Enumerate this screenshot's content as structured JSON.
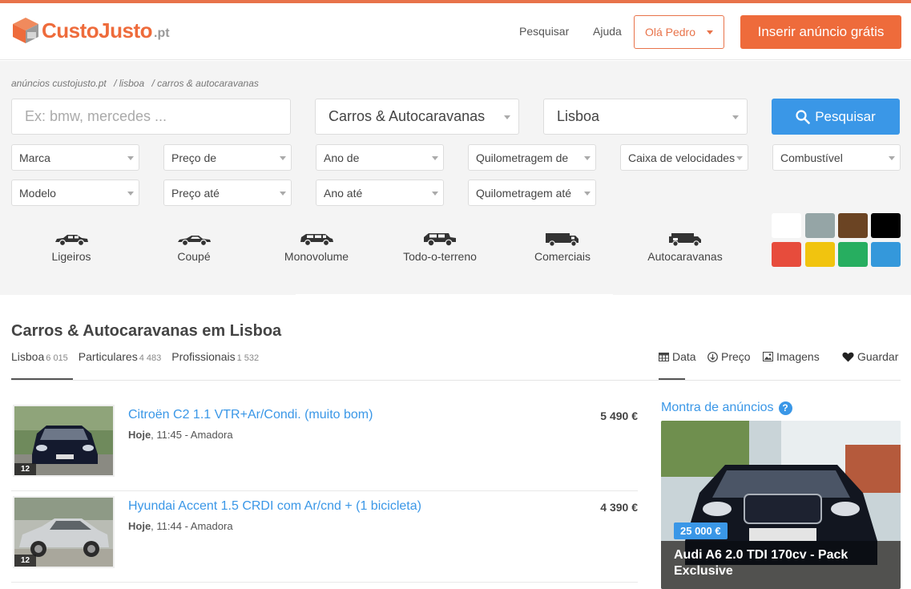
{
  "brand": {
    "name": "CustoJusto",
    "tld": ".pt",
    "accent": "#ee6b3b",
    "link_color": "#3a97e7"
  },
  "nav": {
    "search": "Pesquisar",
    "help": "Ajuda",
    "user": "Olá Pedro",
    "cta": "Inserir anúncio grátis"
  },
  "breadcrumb": [
    "anúncios custojusto.pt",
    "/ lisboa",
    "/ carros & autocaravanas"
  ],
  "search": {
    "query_placeholder": "Ex: bmw, mercedes ...",
    "category": "Carros & Autocaravanas",
    "region": "Lisboa",
    "button": "Pesquisar"
  },
  "filters": {
    "brand": "Marca",
    "price_from": "Preço de",
    "year_from": "Ano de",
    "km_from": "Quilometragem de",
    "gearbox": "Caixa de velocidades",
    "fuel": "Combustível",
    "model": "Modelo",
    "price_to": "Preço até",
    "year_to": "Ano até",
    "km_to": "Quilometragem até"
  },
  "body_types": [
    {
      "label": "Ligeiros",
      "icon": "sedan-icon"
    },
    {
      "label": "Coupé",
      "icon": "coupe-icon"
    },
    {
      "label": "Monovolume",
      "icon": "minivan-icon"
    },
    {
      "label": "Todo-o-terreno",
      "icon": "suv-icon"
    },
    {
      "label": "Comerciais",
      "icon": "truck-icon"
    },
    {
      "label": "Autocaravanas",
      "icon": "camper-icon"
    }
  ],
  "colors": [
    "#ffffff",
    "#95a5a6",
    "#6b4423",
    "#000000",
    "#e74c3c",
    "#f1c40f",
    "#27ae60",
    "#3498db"
  ],
  "results": {
    "title": "Carros & Autocaravanas em Lisboa",
    "tabs": [
      {
        "label": "Lisboa",
        "count": "6 015"
      },
      {
        "label": "Particulares",
        "count": "4 483"
      },
      {
        "label": "Profissionais",
        "count": "1 532"
      }
    ],
    "sort": {
      "date": "Data",
      "price": "Preço",
      "images": "Imagens",
      "save": "Guardar"
    }
  },
  "listings": [
    {
      "title": "Citroën C2 1.1 VTR+Ar/Condi. (muito bom)",
      "day": "Hoje",
      "time_place": ", 11:45 - Amadora",
      "price": "5 490 €",
      "photos": "12"
    },
    {
      "title": "Hyundai Accent 1.5 CRDI com Ar/cnd + (1 bicicleta)",
      "day": "Hoje",
      "time_place": ", 11:44 - Amadora",
      "price": "4 390 €",
      "photos": "12"
    }
  ],
  "showcase": {
    "heading": "Montra de anúncios",
    "help": "?",
    "price": "25 000 €",
    "title": "Audi A6 2.0 TDI 170cv - Pack Exclusive"
  }
}
